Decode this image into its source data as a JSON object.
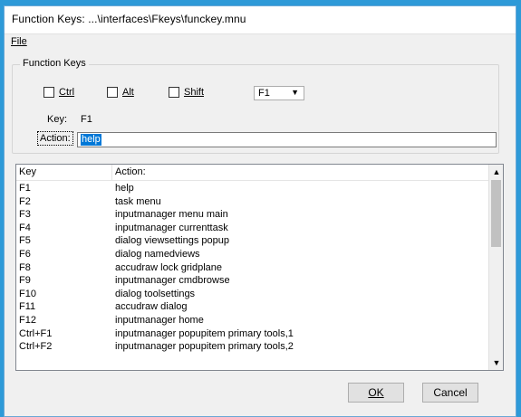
{
  "window": {
    "title": "Function Keys: ...\\interfaces\\Fkeys\\funckey.mnu"
  },
  "menu": {
    "file": "File"
  },
  "group": {
    "label": "Function Keys"
  },
  "modifiers": {
    "ctrl": "Ctrl",
    "alt": "Alt",
    "shift": "Shift"
  },
  "key_select": {
    "value": "F1"
  },
  "key_display": {
    "label": "Key:",
    "value": "F1"
  },
  "action": {
    "label": "Action:",
    "value": "help"
  },
  "list": {
    "headers": {
      "key": "Key",
      "action": "Action:"
    },
    "rows": [
      {
        "key": "F1",
        "action": "help"
      },
      {
        "key": "F2",
        "action": "task menu"
      },
      {
        "key": "F3",
        "action": "inputmanager menu main"
      },
      {
        "key": "F4",
        "action": "inputmanager currenttask"
      },
      {
        "key": "F5",
        "action": "dialog viewsettings popup"
      },
      {
        "key": "F6",
        "action": "dialog namedviews"
      },
      {
        "key": "F8",
        "action": "accudraw lock gridplane"
      },
      {
        "key": "F9",
        "action": "inputmanager cmdbrowse"
      },
      {
        "key": "F10",
        "action": "dialog toolsettings"
      },
      {
        "key": "F11",
        "action": "accudraw dialog"
      },
      {
        "key": "F12",
        "action": "inputmanager home"
      },
      {
        "key": "Ctrl+F1",
        "action": "inputmanager popupitem primary tools,1"
      },
      {
        "key": "Ctrl+F2",
        "action": "inputmanager popupitem primary tools,2"
      }
    ]
  },
  "buttons": {
    "ok": "OK",
    "cancel": "Cancel"
  }
}
